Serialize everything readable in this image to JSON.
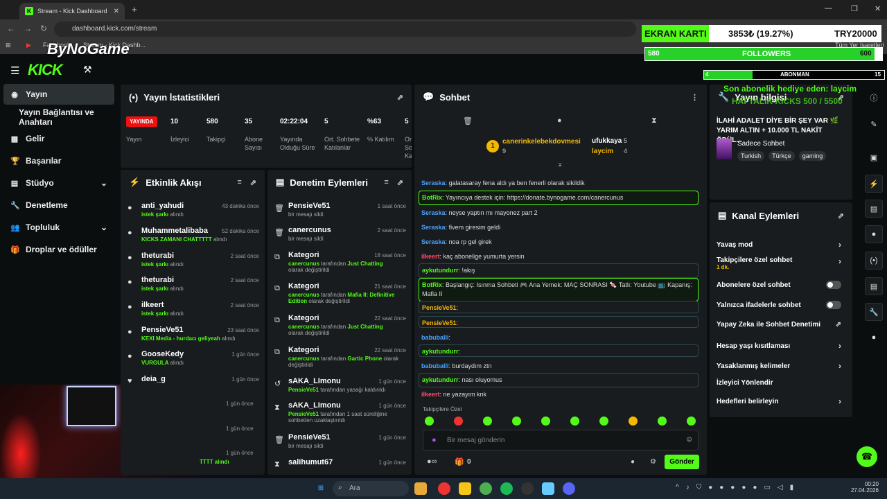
{
  "browser": {
    "tab_title": "Stream - Kick Dashboard",
    "url": "dashboard.kick.com/stream",
    "bookmarks": [
      "Facebook",
      "Stream - Kick Dashb..."
    ],
    "all_bookmarks": "Tüm Yer İşaretleri"
  },
  "overlay": {
    "brand": "ByNoGame",
    "card_label": "EKRAN KARTI",
    "card_price": "3853₺ (19.27%)",
    "card_target": "TRY20000",
    "followers_current": "580",
    "followers_label": "FOLLOWERS",
    "followers_goal": "600",
    "followers_progress": 0.967,
    "subs_current": "4",
    "subs_label": "ABONMAN",
    "subs_goal": "15",
    "subs_progress": 0.27,
    "last_sub_gift": "Son abonelik hediye eden: laycim",
    "kicks_line": "HAFTALIK KICKS 500 / 5500"
  },
  "sidebar": {
    "items": [
      "Yayın",
      "Yayın Bağlantısı ve Anahtarı",
      "Gelir",
      "Başarılar",
      "Stüdyo",
      "Denetleme",
      "Topluluk",
      "Droplar ve ödüller"
    ]
  },
  "stats": {
    "title": "Yayın İstatistikleri",
    "live": "YAYINDA",
    "live_label": "Yayın",
    "cols": [
      {
        "v": "10",
        "l": "İzleyici"
      },
      {
        "v": "580",
        "l": "Takipçi"
      },
      {
        "v": "35",
        "l": "Abone Sayısı"
      },
      {
        "v": "02:22:04",
        "l": "Yayında Olduğu Süre"
      },
      {
        "v": "5",
        "l": "Ort. Sohbete Katılanlar"
      },
      {
        "v": "%63",
        "l": "% Katılım"
      },
      {
        "v": "5",
        "l": "Or So Ka"
      }
    ]
  },
  "activity": {
    "title": "Etkinlik Akışı",
    "items": [
      {
        "n": "anti_yahudi",
        "s": "istek şarkı",
        "a": "alındı",
        "t": "43 dakika önce"
      },
      {
        "n": "Muhammetalibaba",
        "s": "KICKS ZAMANI CHATTTTT",
        "a": "alındı",
        "t": "52 dakika önce"
      },
      {
        "n": "theturabi",
        "s": "istek şarkı",
        "a": "alındı",
        "t": "2 saat önce"
      },
      {
        "n": "theturabi",
        "s": "istek şarkı",
        "a": "alındı",
        "t": "2 saat önce"
      },
      {
        "n": "ilkeert",
        "s": "istek şarkı",
        "a": "alındı",
        "t": "2 saat önce"
      },
      {
        "n": "PensieVe51",
        "s": "KEXI Media - hurdacı geliyeah",
        "a": "alındı",
        "t": "23 saat önce"
      },
      {
        "n": "GooseKedy",
        "s": "VURGULA",
        "a": "alındı",
        "t": "1 gün önce"
      },
      {
        "n": "deia_g",
        "s": "",
        "a": "",
        "t": "1 gün önce"
      }
    ],
    "extra_times": [
      "1 gün önce",
      "1 gün önce",
      "1 gün önce"
    ],
    "trail": "TTTT alındı"
  },
  "moderation": {
    "title": "Denetim Eylemleri",
    "items": [
      {
        "n": "PensieVe51",
        "s": "bir mesajı sildi",
        "t": "1 saat önce"
      },
      {
        "n": "canercunus",
        "s": "bir mesajı sildi",
        "t": "2 saat önce"
      },
      {
        "n": "Kategori",
        "s1": "canercunus",
        "s2": "tarafından",
        "s3": "Just Chatting",
        "s4": "olarak değiştirildi",
        "t": "18 saat önce"
      },
      {
        "n": "Kategori",
        "s1": "canercunus",
        "s2": "tarafından",
        "s3": "Mafia II: Definitive Edition",
        "s4": "olarak değiştirildi",
        "t": "21 saat önce"
      },
      {
        "n": "Kategori",
        "s1": "canercunus",
        "s2": "tarafından",
        "s3": "Just Chatting",
        "s4": "olarak değiştirildi",
        "t": "22 saat önce"
      },
      {
        "n": "Kategori",
        "s1": "canercunus",
        "s2": "tarafından",
        "s3": "Gartic Phone",
        "s4": "olarak değiştirildi",
        "t": "22 saat önce"
      },
      {
        "n": "sAKA_LImonu",
        "s1": "PensieVe51",
        "s2": "tarafından yasağı kaldırıldı",
        "t": "1 gün önce"
      },
      {
        "n": "sAKA_LImonu",
        "s1": "PensieVe51",
        "s2": "tarafından 1 saat süreliğine sohbetten uzaklaştırıldı",
        "t": "1 gün önce"
      },
      {
        "n": "PensieVe51",
        "s": "bir mesajı sildi",
        "t": "1 gün önce"
      },
      {
        "n": "salihumut67",
        "s": "",
        "t": "1 gün önce"
      }
    ]
  },
  "chat": {
    "title": "Sohbet",
    "top1": "canerinkelebekdovmesi",
    "top1_count": "9",
    "top2": "ufukkaya",
    "top2_count": "5",
    "top3": "laycim",
    "top3_count": "4",
    "messages": [
      {
        "u": "Seraska",
        "m": "galatasaray fena aldı ya ben fenerli olarak sikildik"
      },
      {
        "u": "BotRix",
        "m": "Yayıncıya destek için: https://donate.bynogame.com/canercunus"
      },
      {
        "u": "Seraska",
        "m": "neyse yaptın mı mayonez part 2"
      },
      {
        "u": "Seraska",
        "m": "fivem giresim geldi"
      },
      {
        "u": "Seraska",
        "m": "noa rp gel girek"
      },
      {
        "u": "ilkeert",
        "m": "kaç abonelige yumurta yersin"
      },
      {
        "u": "aykutundurr",
        "m": "!akış"
      },
      {
        "u": "BotRix",
        "m": "Başlangıç: Isınma Sohbeti 🎮 Ana Yemek: MAÇ SONRASI 🍬 Tatlı: Youtube 📺 Kapanış: Mafia II"
      },
      {
        "u": "PensieVe51",
        "m": ""
      },
      {
        "u": "PensieVe51",
        "m": ""
      },
      {
        "u": "babuballi",
        "m": ""
      },
      {
        "u": "aykutundurr",
        "m": ""
      },
      {
        "u": "babuballi",
        "m": "burdaydım ztn"
      },
      {
        "u": "aykutundurr",
        "m": "nası oluyomus"
      },
      {
        "u": "ilkeert",
        "m": "ne yazayım knk"
      }
    ],
    "followers_only": "Takipçilere Özel",
    "placeholder": "Bir mesaj gönderin",
    "send": "Gönder",
    "count": "0"
  },
  "stream_info": {
    "title": "Yayın bilgisi",
    "stream_title": "İLAHİ ADALET DİYE BİR ŞEY VAR 🌿 YARIM ALTIN + 10.000 TL NAKİT ÖDÜL...",
    "category": "Sadece Sohbet",
    "tags": [
      "Turkish",
      "Türkçe",
      "gaming"
    ]
  },
  "channel_actions": {
    "title": "Kanal Eylemleri",
    "items": [
      {
        "l": "Yavaş mod",
        "k": "arrow"
      },
      {
        "l": "Takipçilere özel sohbet",
        "sub": "1 dk.",
        "k": "arrow"
      },
      {
        "l": "Abonelere özel sohbet",
        "k": "toggle"
      },
      {
        "l": "Yalnızca ifadelerle sohbet",
        "k": "toggle"
      },
      {
        "l": "Yapay Zeka ile Sohbet Denetimi",
        "k": "ext"
      },
      {
        "l": "Hesap yaşı kısıtlaması",
        "k": "arrow"
      },
      {
        "l": "Yasaklanmış kelimeler",
        "k": "arrow"
      },
      {
        "l": "İzleyici Yönlendir",
        "k": ""
      },
      {
        "l": "Hedefleri belirleyin",
        "k": "arrow"
      }
    ]
  },
  "taskbar": {
    "search": "Ara",
    "time": "00:20",
    "date": "27.04.2026"
  },
  "colors": {
    "accent": "#53fc18",
    "blue_user": "#4aa3ff",
    "red_user": "#ff4d6d",
    "gold": "#f5b800"
  }
}
